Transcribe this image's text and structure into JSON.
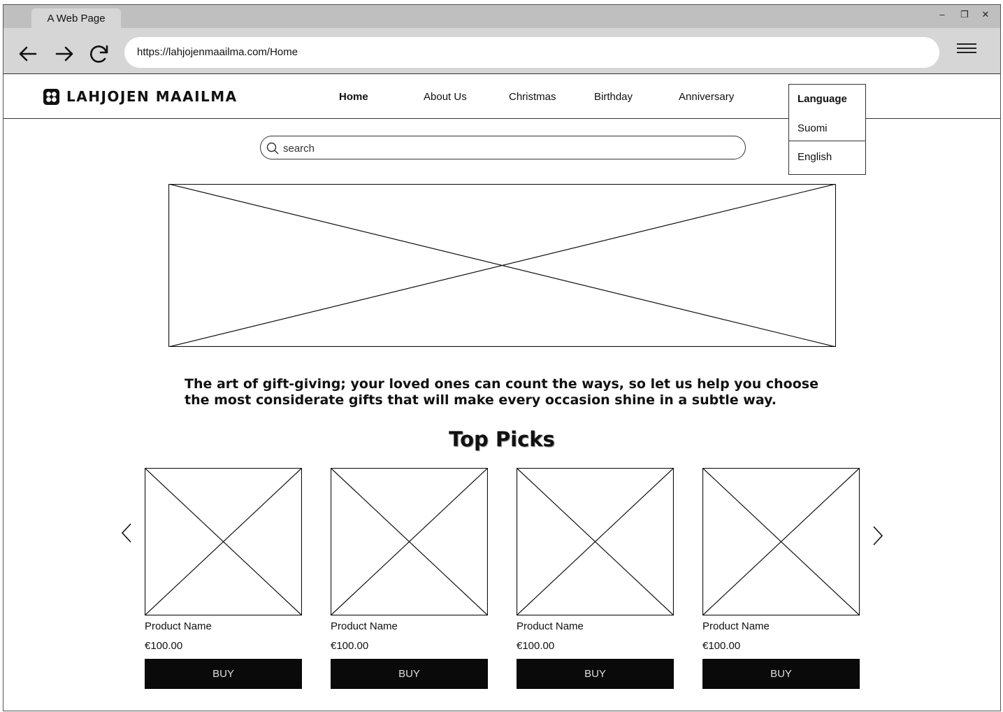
{
  "browser": {
    "tab_title": "A Web Page",
    "url": "https://lahjojenmaailma.com/Home",
    "controls": {
      "minimize": "–",
      "restore": "❐",
      "close": "✕"
    }
  },
  "site": {
    "brand": "LAHJOJEN MAAILMA",
    "nav": [
      {
        "label": "Home"
      },
      {
        "label": "About Us"
      },
      {
        "label": "Christmas"
      },
      {
        "label": "Birthday"
      },
      {
        "label": "Anniversary"
      }
    ],
    "language": {
      "title": "Language",
      "options": [
        "Suomi",
        "English"
      ]
    }
  },
  "search": {
    "placeholder": "search"
  },
  "tagline": "The art of gift-giving; your loved ones can count the ways, so let us help you choose the most considerate gifts that will make every occasion shine in a subtle way.",
  "top_picks": {
    "title": "Top Picks",
    "products": [
      {
        "name": "Product Name",
        "price": "€100.00",
        "button": "BUY"
      },
      {
        "name": "Product Name",
        "price": "€100.00",
        "button": "BUY"
      },
      {
        "name": "Product Name",
        "price": "€100.00",
        "button": "BUY"
      },
      {
        "name": "Product Name",
        "price": "€100.00",
        "button": "BUY"
      }
    ]
  },
  "icons": [
    "back-arrow-icon",
    "forward-arrow-icon",
    "reload-icon",
    "hamburger-menu-icon",
    "search-icon",
    "chevron-left-icon",
    "chevron-right-icon",
    "flower-logo-icon"
  ]
}
